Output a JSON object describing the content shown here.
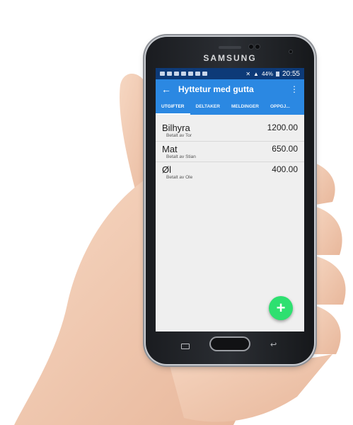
{
  "device": {
    "brand": "SAMSUNG"
  },
  "status_bar": {
    "time": "20:55",
    "battery": "44%"
  },
  "app_bar": {
    "title": "Hyttetur med gutta",
    "back_icon": "arrow-left-icon",
    "menu_icon": "more-vert-icon"
  },
  "tabs": [
    {
      "label": "UTGIFTER",
      "active": true
    },
    {
      "label": "DELTAKER",
      "active": false
    },
    {
      "label": "MELDINGER",
      "active": false
    },
    {
      "label": "OPPGJ...",
      "active": false
    }
  ],
  "expenses": [
    {
      "name": "Bilhyra",
      "amount": "1200.00",
      "paid_by": "Betalt av Tor"
    },
    {
      "name": "Mat",
      "amount": "650.00",
      "paid_by": "Betalt av Stian"
    },
    {
      "name": "Øl",
      "amount": "400.00",
      "paid_by": "Betalt av Ole"
    }
  ],
  "fab": {
    "icon": "plus-icon",
    "label": "+"
  },
  "colors": {
    "app_bar": "#2b88e2",
    "status_bar": "#0d3a78",
    "fab": "#2ee070"
  }
}
